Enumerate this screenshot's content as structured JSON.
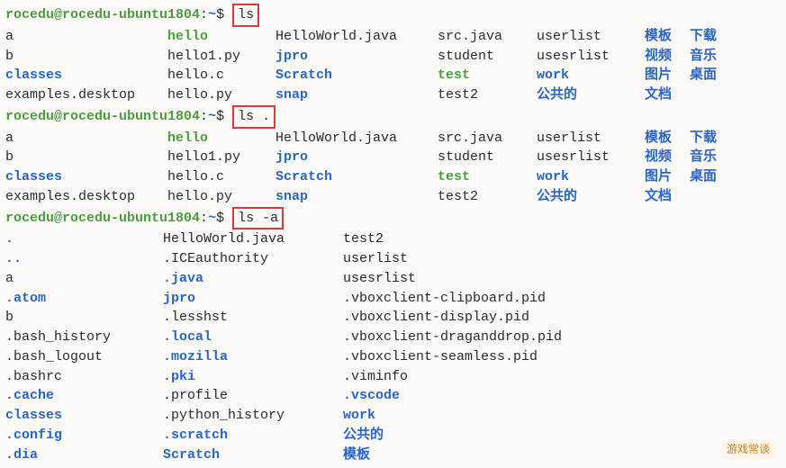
{
  "prompt": {
    "user": "rocedu@rocedu-ubuntu1804",
    "sep": ":",
    "path": "~",
    "sym": "$"
  },
  "cmds": {
    "ls": "ls",
    "lsdot": "ls .",
    "lsa": "ls -a"
  },
  "ls_out": [
    [
      {
        "t": "a",
        "c": "reg"
      },
      {
        "t": "hello",
        "c": "exec"
      },
      {
        "t": "HelloWorld.java",
        "c": "reg"
      },
      {
        "t": "src.java",
        "c": "reg"
      },
      {
        "t": "userlist",
        "c": "reg"
      },
      {
        "t": "模板",
        "c": "dir"
      },
      {
        "t": "下载",
        "c": "dir"
      }
    ],
    [
      {
        "t": "b",
        "c": "reg"
      },
      {
        "t": "hello1.py",
        "c": "reg"
      },
      {
        "t": "jpro",
        "c": "dir"
      },
      {
        "t": "student",
        "c": "reg"
      },
      {
        "t": "usesrlist",
        "c": "reg"
      },
      {
        "t": "视频",
        "c": "dir"
      },
      {
        "t": "音乐",
        "c": "dir"
      }
    ],
    [
      {
        "t": "classes",
        "c": "dir"
      },
      {
        "t": "hello.c",
        "c": "reg"
      },
      {
        "t": "Scratch",
        "c": "dir"
      },
      {
        "t": "test",
        "c": "exec"
      },
      {
        "t": "work",
        "c": "dir"
      },
      {
        "t": "图片",
        "c": "dir"
      },
      {
        "t": "桌面",
        "c": "dir"
      }
    ],
    [
      {
        "t": "examples.desktop",
        "c": "reg"
      },
      {
        "t": "hello.py",
        "c": "reg"
      },
      {
        "t": "snap",
        "c": "dir"
      },
      {
        "t": "test2",
        "c": "reg"
      },
      {
        "t": "公共的",
        "c": "dir"
      },
      {
        "t": "文档",
        "c": "dir"
      },
      {
        "t": "",
        "c": "reg"
      }
    ]
  ],
  "lsdot_out": [
    [
      {
        "t": "a",
        "c": "reg"
      },
      {
        "t": "hello",
        "c": "exec"
      },
      {
        "t": "HelloWorld.java",
        "c": "reg"
      },
      {
        "t": "src.java",
        "c": "reg"
      },
      {
        "t": "userlist",
        "c": "reg"
      },
      {
        "t": "模板",
        "c": "dir"
      },
      {
        "t": "下载",
        "c": "dir"
      }
    ],
    [
      {
        "t": "b",
        "c": "reg"
      },
      {
        "t": "hello1.py",
        "c": "reg"
      },
      {
        "t": "jpro",
        "c": "dir"
      },
      {
        "t": "student",
        "c": "reg"
      },
      {
        "t": "usesrlist",
        "c": "reg"
      },
      {
        "t": "视频",
        "c": "dir"
      },
      {
        "t": "音乐",
        "c": "dir"
      }
    ],
    [
      {
        "t": "classes",
        "c": "dir"
      },
      {
        "t": "hello.c",
        "c": "reg"
      },
      {
        "t": "Scratch",
        "c": "dir"
      },
      {
        "t": "test",
        "c": "exec"
      },
      {
        "t": "work",
        "c": "dir"
      },
      {
        "t": "图片",
        "c": "dir"
      },
      {
        "t": "桌面",
        "c": "dir"
      }
    ],
    [
      {
        "t": "examples.desktop",
        "c": "reg"
      },
      {
        "t": "hello.py",
        "c": "reg"
      },
      {
        "t": "snap",
        "c": "dir"
      },
      {
        "t": "test2",
        "c": "reg"
      },
      {
        "t": "公共的",
        "c": "dir"
      },
      {
        "t": "文档",
        "c": "dir"
      },
      {
        "t": "",
        "c": "reg"
      }
    ]
  ],
  "lsa_out": [
    [
      {
        "t": ".",
        "c": "dir"
      },
      {
        "t": "HelloWorld.java",
        "c": "reg"
      },
      {
        "t": "test2",
        "c": "reg"
      }
    ],
    [
      {
        "t": "..",
        "c": "dir"
      },
      {
        "t": ".ICEauthority",
        "c": "reg"
      },
      {
        "t": "userlist",
        "c": "reg"
      }
    ],
    [
      {
        "t": "a",
        "c": "reg"
      },
      {
        "t": ".java",
        "c": "dir"
      },
      {
        "t": "usesrlist",
        "c": "reg"
      }
    ],
    [
      {
        "t": ".atom",
        "c": "dir"
      },
      {
        "t": "jpro",
        "c": "dir"
      },
      {
        "t": ".vboxclient-clipboard.pid",
        "c": "reg"
      }
    ],
    [
      {
        "t": "b",
        "c": "reg"
      },
      {
        "t": ".lesshst",
        "c": "reg"
      },
      {
        "t": ".vboxclient-display.pid",
        "c": "reg"
      }
    ],
    [
      {
        "t": ".bash_history",
        "c": "reg"
      },
      {
        "t": ".local",
        "c": "dir"
      },
      {
        "t": ".vboxclient-draganddrop.pid",
        "c": "reg"
      }
    ],
    [
      {
        "t": ".bash_logout",
        "c": "reg"
      },
      {
        "t": ".mozilla",
        "c": "dir"
      },
      {
        "t": ".vboxclient-seamless.pid",
        "c": "reg"
      }
    ],
    [
      {
        "t": ".bashrc",
        "c": "reg"
      },
      {
        "t": ".pki",
        "c": "dir"
      },
      {
        "t": ".viminfo",
        "c": "reg"
      }
    ],
    [
      {
        "t": ".cache",
        "c": "dir"
      },
      {
        "t": ".profile",
        "c": "reg"
      },
      {
        "t": ".vscode",
        "c": "dir"
      }
    ],
    [
      {
        "t": "classes",
        "c": "dir"
      },
      {
        "t": ".python_history",
        "c": "reg"
      },
      {
        "t": "work",
        "c": "dir"
      }
    ],
    [
      {
        "t": ".config",
        "c": "dir"
      },
      {
        "t": ".scratch",
        "c": "dir"
      },
      {
        "t": "公共的",
        "c": "dir"
      }
    ],
    [
      {
        "t": ".dia",
        "c": "dir"
      },
      {
        "t": "Scratch",
        "c": "dir"
      },
      {
        "t": "模板",
        "c": "dir"
      }
    ]
  ],
  "watermark": "游戏常谈"
}
